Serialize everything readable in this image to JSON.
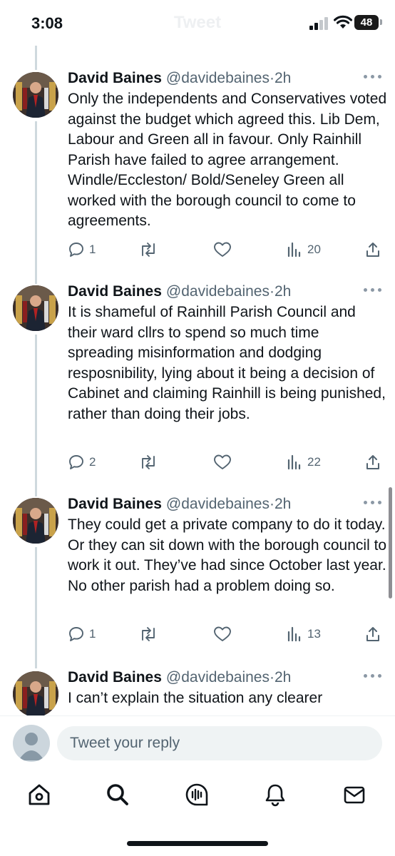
{
  "status_bar": {
    "time": "3:08",
    "battery": "48",
    "screen_title": "Tweet"
  },
  "tweets": [
    {
      "name": "David Baines",
      "handle": "@davidebaines",
      "separator": "·",
      "time_ago": "2h",
      "text": "Only the independents and Conservatives voted against the budget which agreed this. Lib Dem, Labour and Green all in favour. Only Rainhill Parish have failed to agree arrangement. Windle/Eccleston/ Bold/Seneley Green all worked with the borough council to come to agreements.",
      "replies": "1",
      "retweets": "",
      "likes": "",
      "views": "20"
    },
    {
      "name": "David Baines",
      "handle": "@davidebaines",
      "separator": "·",
      "time_ago": "2h",
      "text": "It is shameful of Rainhill Parish Council and their ward cllrs to spend so much time spreading misinformation and dodging resposnibility, lying about it being a decision of Cabinet and claiming Rainhill is being punished, rather than doing their jobs.",
      "replies": "2",
      "retweets": "",
      "likes": "",
      "views": "22"
    },
    {
      "name": "David Baines",
      "handle": "@davidebaines",
      "separator": "·",
      "time_ago": "2h",
      "text": "They could get a private company to do it today. Or they can sit down with the borough council to work it out. They’ve had since October last year. No other parish had a problem doing so.",
      "replies": "1",
      "retweets": "",
      "likes": "",
      "views": "13"
    },
    {
      "name": "David Baines",
      "handle": "@davidebaines",
      "separator": "·",
      "time_ago": "2h",
      "text": "I can’t explain the situation any clearer"
    }
  ],
  "reply": {
    "placeholder": "Tweet your reply"
  },
  "tabs": [
    "home",
    "search",
    "spaces",
    "notifications",
    "messages"
  ],
  "colors": {
    "text": "#0f1419",
    "secondary": "#536471",
    "thread_line": "#cfd9de",
    "input_bg": "#eff3f4"
  }
}
